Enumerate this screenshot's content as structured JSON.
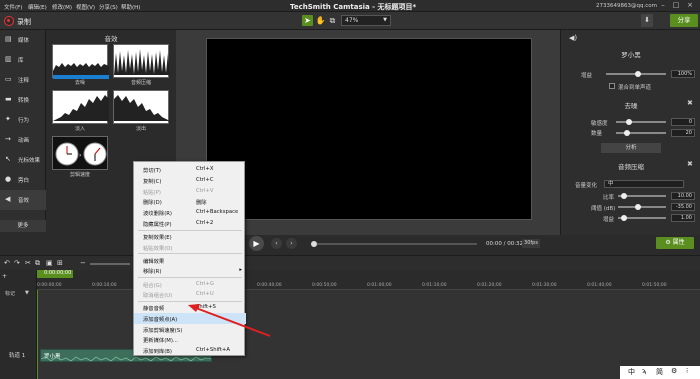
{
  "menubar": {
    "items": [
      "文件(F)",
      "编辑(E)",
      "修改(M)",
      "视图(V)",
      "分享(S)",
      "帮助(H)"
    ],
    "title": "TechSmith Camtasia - 无标题项目*",
    "user": "2733649863@qq.com"
  },
  "toolbar": {
    "record_label": "录制",
    "zoom_value": "47%",
    "share_label": "分享"
  },
  "left_nav": {
    "items": [
      {
        "label": "媒体",
        "icon": "media-icon"
      },
      {
        "label": "库",
        "icon": "library-icon"
      },
      {
        "label": "注释",
        "icon": "annotation-icon"
      },
      {
        "label": "转换",
        "icon": "transition-icon"
      },
      {
        "label": "行为",
        "icon": "behavior-icon"
      },
      {
        "label": "动画",
        "icon": "animation-icon"
      },
      {
        "label": "光标效果",
        "icon": "cursor-icon"
      },
      {
        "label": "旁白",
        "icon": "narration-icon"
      },
      {
        "label": "音效",
        "icon": "audio-effects-icon"
      }
    ],
    "more_label": "更多"
  },
  "effects_panel": {
    "title": "音效",
    "thumbs": [
      "去噪",
      "音频压缩",
      "淡入",
      "淡出",
      "剪辑速度"
    ]
  },
  "properties": {
    "panel_name": "罗小黑",
    "gain_label": "增益",
    "gain_value": "100%",
    "mix_mono_label": "混合到单声道",
    "denoise_title": "去噪",
    "sensitivity_label": "敏感度",
    "sensitivity_value": "0",
    "amount_label": "数量",
    "amount_value": "20",
    "analyze_label": "分析",
    "compression_title": "音频压缩",
    "volume_change_label": "音量变化",
    "volume_change_value": "中",
    "ratio_label": "比率",
    "ratio_value": "10.00",
    "threshold_label": "阈值 (dB)",
    "threshold_value": "-35.00",
    "gain_db_label": "增益",
    "gain_db_value": "1.00"
  },
  "playback": {
    "time": "00:00 / 00:32",
    "fps": "30fps",
    "attr_label": "属性"
  },
  "timeline": {
    "playhead_time": "0:00:00;00",
    "ticks": [
      "0:00:00;00",
      "0:00:10;00",
      "0:00:20;00",
      "0:00:30;00",
      "0:00:40;00",
      "0:00:50;00",
      "0:01:00;00",
      "0:01:10;00",
      "0:01:20;00",
      "0:01:30;00",
      "0:01:40;00",
      "0:01:50;00"
    ],
    "marker_label": "标记",
    "track_label": "轨道 1",
    "clip_label": "罗小黑"
  },
  "context_menu": {
    "items": [
      {
        "label": "剪切(T)",
        "shortcut": "Ctrl+X",
        "disabled": false
      },
      {
        "label": "复制(C)",
        "shortcut": "Ctrl+C",
        "disabled": false
      },
      {
        "label": "粘贴(P)",
        "shortcut": "Ctrl+V",
        "disabled": true
      },
      {
        "label": "删除(D)",
        "shortcut": "删除",
        "disabled": false
      },
      {
        "label": "波纹删除(R)",
        "shortcut": "Ctrl+Backspace",
        "disabled": false
      },
      {
        "label": "隐藏属性(P)",
        "shortcut": "Ctrl+2",
        "disabled": false
      },
      {
        "label": "复制效果(E)",
        "shortcut": "",
        "disabled": false
      },
      {
        "label": "粘贴效果(O)",
        "shortcut": "",
        "disabled": true
      },
      {
        "label": "编辑效果",
        "shortcut": "",
        "disabled": false
      },
      {
        "label": "移除(R)",
        "shortcut": "",
        "disabled": false,
        "submenu": true
      },
      {
        "label": "组合(G)",
        "shortcut": "Ctrl+G",
        "disabled": true
      },
      {
        "label": "取消组合(U)",
        "shortcut": "Ctrl+U",
        "disabled": true
      },
      {
        "label": "静音音频",
        "shortcut": "Shift+S",
        "disabled": false
      },
      {
        "label": "添加音频点(A)",
        "shortcut": "",
        "disabled": false
      },
      {
        "label": "添加剪辑速度(S)",
        "shortcut": "",
        "disabled": false
      },
      {
        "label": "更新媒体(M)...",
        "shortcut": "",
        "disabled": false
      },
      {
        "label": "添加到库(B)",
        "shortcut": "Ctrl+Shift+A",
        "disabled": false
      }
    ]
  },
  "taskbar": {
    "items": [
      "中",
      "ϡ",
      "简",
      "⚙",
      "⁝"
    ]
  }
}
